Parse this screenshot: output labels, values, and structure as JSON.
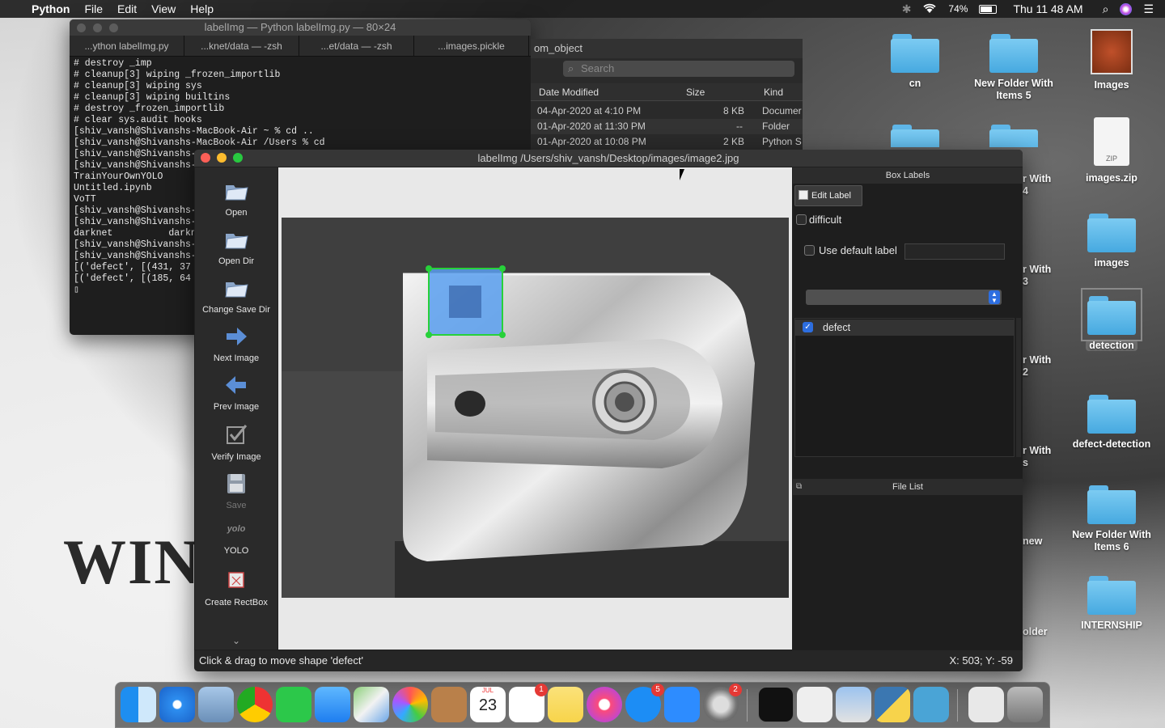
{
  "menubar": {
    "app_name": "Python",
    "items": [
      "File",
      "Edit",
      "View",
      "Help"
    ],
    "battery": "74%",
    "clock": "Thu 11 48 AM"
  },
  "terminal": {
    "title": "labelImg — Python labelImg.py — 80×24",
    "tabs": [
      "...ython labelImg.py",
      "...knet/data — -zsh",
      "...et/data — -zsh",
      "...images.pickle"
    ],
    "lines": [
      "# destroy _imp",
      "# cleanup[3] wiping _frozen_importlib",
      "# cleanup[3] wiping sys",
      "# cleanup[3] wiping builtins",
      "# destroy _frozen_importlib",
      "# clear sys.audit hooks",
      "[shiv_vansh@Shivanshs-MacBook-Air ~ % cd ..",
      "[shiv_vansh@Shivanshs-MacBook-Air /Users % cd",
      "[shiv_vansh@Shivanshs-",
      "[shiv_vansh@Shivanshs-",
      "TrainYourOwnYOLO",
      "Untitled.ipynb",
      "VoTT",
      "[shiv_vansh@Shivanshs-",
      "[shiv_vansh@Shivanshs-",
      "darknet          darkn",
      "[shiv_vansh@Shivanshs-",
      "[shiv_vansh@Shivanshs-",
      "[('defect', [(431, 37",
      "[('defect', [(185, 64",
      "▯"
    ]
  },
  "finder": {
    "title": "om_object",
    "search_placeholder": "Search",
    "columns": [
      "Date Modified",
      "Size",
      "Kind"
    ],
    "rows": [
      {
        "date": "04-Apr-2020 at 4:10 PM",
        "size": "8 KB",
        "kind": "Documer"
      },
      {
        "date": "01-Apr-2020 at 11:30 PM",
        "size": "--",
        "kind": "Folder"
      },
      {
        "date": "01-Apr-2020 at 10:08 PM",
        "size": "2 KB",
        "kind": "Python S"
      }
    ]
  },
  "labelimg": {
    "title": "labelImg /Users/shiv_vansh/Desktop/images/image2.jpg",
    "tools": [
      {
        "label": "Open",
        "icon": "folder-open-icon"
      },
      {
        "label": "Open Dir",
        "icon": "folder-open-icon"
      },
      {
        "label": "Change Save Dir",
        "icon": "folder-open-icon"
      },
      {
        "label": "Next Image",
        "icon": "arrow-right-icon"
      },
      {
        "label": "Prev Image",
        "icon": "arrow-left-icon"
      },
      {
        "label": "Verify Image",
        "icon": "checkbox-icon"
      },
      {
        "label": "Save",
        "icon": "save-icon"
      },
      {
        "label": "YOLO",
        "icon": "yolo-format-icon",
        "icon_text": "yolo"
      },
      {
        "label": "Create RectBox",
        "icon": "rectbox-icon"
      }
    ],
    "box_labels_title": "Box Labels",
    "edit_label": "Edit Label",
    "difficult": "difficult",
    "use_default_label": "Use default label",
    "labels": [
      {
        "name": "defect",
        "checked": true
      }
    ],
    "file_list_title": "File List",
    "status": "Click & drag to move shape 'defect'",
    "coords": "X: 503; Y: -59"
  },
  "desktop": {
    "wallpaper_text": "WIN",
    "icons": [
      "cn",
      "New Folder With Items 5",
      "Images",
      "images.zip",
      "images",
      "detection",
      "defect-detection",
      "New Folder With Items 6",
      "INTERNSHIP"
    ],
    "partial_icons": [
      "r With 4",
      "r With 3",
      "r With 2",
      "r With s",
      "new",
      "older"
    ],
    "zip_label": "ZIP"
  },
  "dock": {
    "badges": {
      "reminders": "1",
      "appstore": "5",
      "preferences": "2"
    },
    "calendar_month": "JUL",
    "calendar_day": "23"
  },
  "colors": {
    "selection_box": "#5aa0f0",
    "accent": "#2d6ee0",
    "handle": "#27d13a"
  }
}
